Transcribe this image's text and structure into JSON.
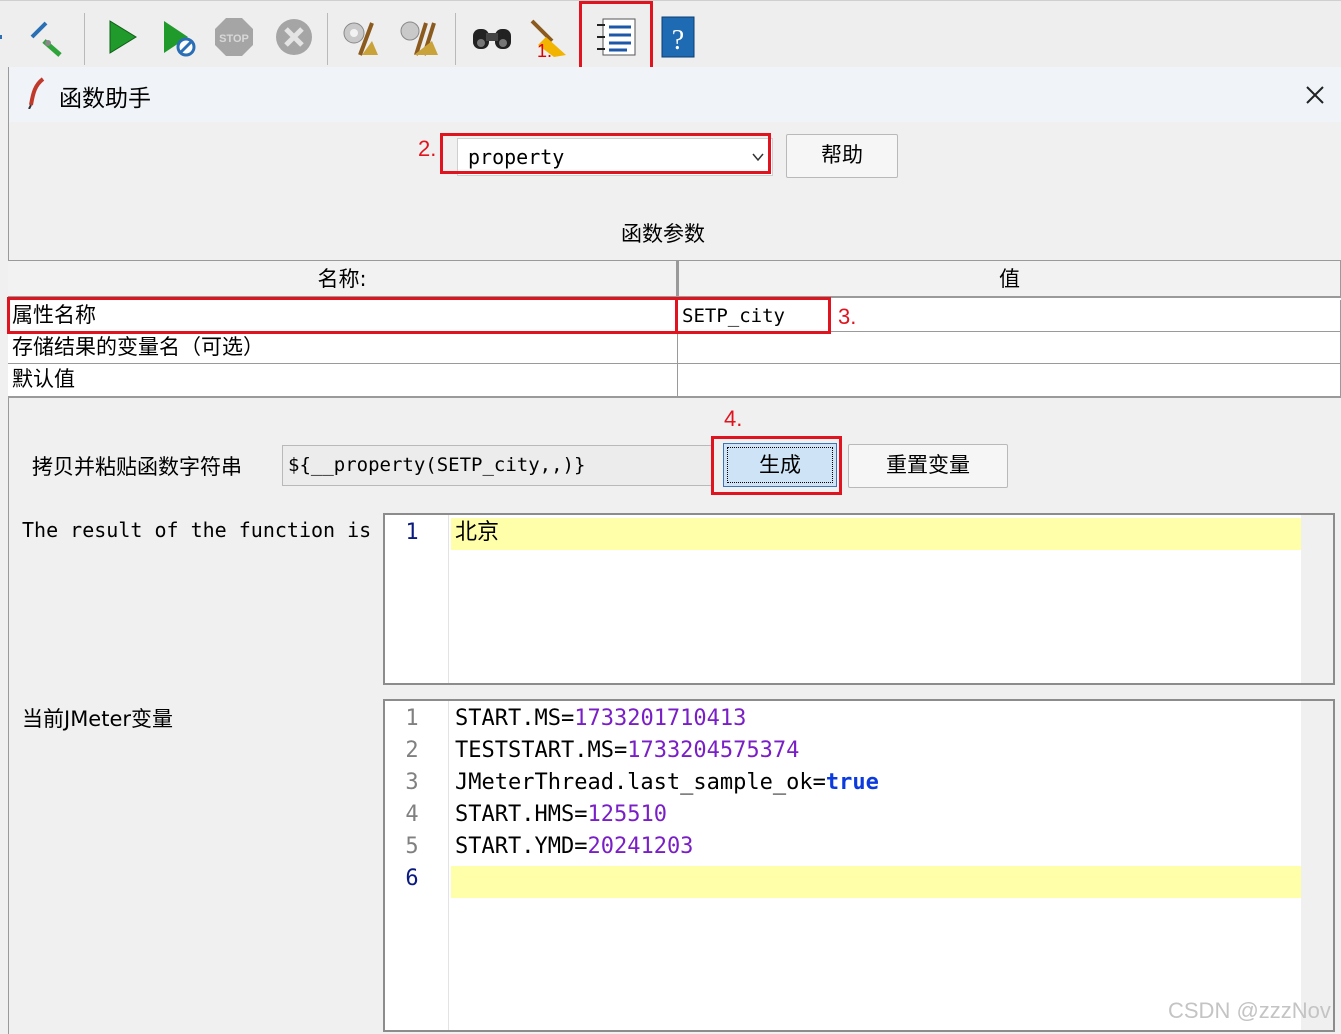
{
  "toolbar": {
    "icons": [
      "remote-icon",
      "pencil-icon",
      "start-icon",
      "start-no-pause-icon",
      "stop-icon",
      "shutdown-icon",
      "clear-icon",
      "clear-all-icon",
      "search-icon",
      "reset-search-icon",
      "function-helper-icon",
      "help-icon"
    ],
    "step_marker": "1."
  },
  "dialog": {
    "title": "函数助手",
    "function_select": {
      "value": "property",
      "step": "2."
    },
    "help_button": "帮助",
    "params_title": "函数参数",
    "table": {
      "headers": [
        "名称:",
        "值"
      ],
      "rows": [
        {
          "name": "属性名称",
          "value": "SETP_city"
        },
        {
          "name": "存储结果的变量名（可选）",
          "value": ""
        },
        {
          "name": "默认值",
          "value": ""
        }
      ],
      "step": "3."
    },
    "copy_label": "拷贝并粘贴函数字符串",
    "function_string": "${__property(SETP_city,,)}",
    "generate_button": "生成",
    "generate_step": "4.",
    "reset_button": "重置变量",
    "result_label": "The result of the function is",
    "result_lines": [
      {
        "n": "1",
        "text": "北京"
      }
    ],
    "vars_label": "当前JMeter变量",
    "vars_lines": [
      {
        "n": "1",
        "key": "START.MS",
        "eq": "=",
        "val": "1733201710413"
      },
      {
        "n": "2",
        "key": "TESTSTART.MS",
        "eq": "=",
        "val": "1733204575374"
      },
      {
        "n": "3",
        "key": "JMeterThread.last_sample_ok",
        "eq": "=",
        "val": "true"
      },
      {
        "n": "4",
        "key": "START.HMS",
        "eq": "=",
        "val": "125510"
      },
      {
        "n": "5",
        "key": "START.YMD",
        "eq": "=",
        "val": "20241203"
      },
      {
        "n": "6",
        "key": "",
        "eq": "",
        "val": ""
      }
    ]
  },
  "colors": {
    "annotation_red": "#e0141e",
    "highlight_line": "#ffffaa",
    "number_purple": "#7a1fc6",
    "keyword_blue": "#0b3bdf"
  },
  "watermark": "CSDN @zzzNov"
}
